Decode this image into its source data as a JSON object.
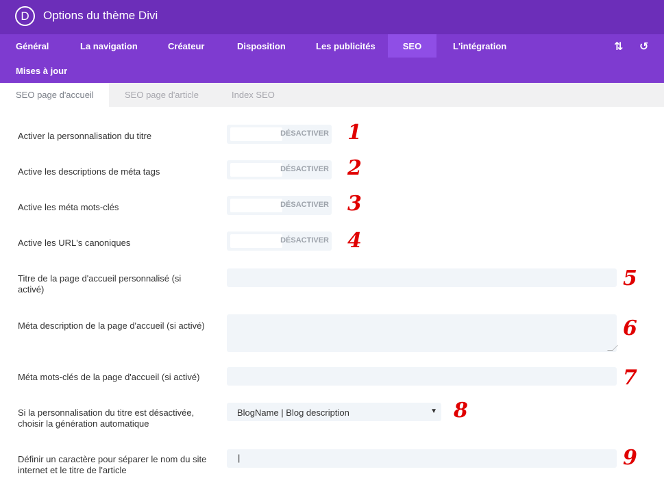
{
  "app": {
    "logo_letter": "D",
    "title": "Options du thème Divi"
  },
  "nav": {
    "tabs": [
      {
        "label": "Général"
      },
      {
        "label": "La navigation"
      },
      {
        "label": "Créateur"
      },
      {
        "label": "Disposition"
      },
      {
        "label": "Les publicités"
      },
      {
        "label": "SEO",
        "active": true
      },
      {
        "label": "L'intégration"
      },
      {
        "label": "Mises à jour"
      }
    ],
    "icons": [
      "sort-arrows-icon",
      "reset-icon"
    ]
  },
  "subtabs": [
    {
      "label": "SEO page d'accueil",
      "active": true
    },
    {
      "label": "SEO page d'article"
    },
    {
      "label": "Index SEO"
    }
  ],
  "options": [
    {
      "label": "Activer la personnalisation du titre",
      "control": "toggle",
      "state": "DÉSACTIVER",
      "marker": "1"
    },
    {
      "label": "Active les descriptions de méta tags",
      "control": "toggle",
      "state": "DÉSACTIVER",
      "marker": "2"
    },
    {
      "label": "Active les méta mots-clés",
      "control": "toggle",
      "state": "DÉSACTIVER",
      "marker": "3"
    },
    {
      "label": "Active les URL's canoniques",
      "control": "toggle",
      "state": "DÉSACTIVER",
      "marker": "4"
    },
    {
      "label": "Titre de la page d'accueil personnalisé (si activé)",
      "control": "text",
      "value": "",
      "marker": "5"
    },
    {
      "label": "Méta description de la page d'accueil (si activé)",
      "control": "textarea",
      "value": "",
      "marker": "6"
    },
    {
      "label": "Méta mots-clés de la page d'accueil (si activé)",
      "control": "text",
      "value": "",
      "marker": "7"
    },
    {
      "label": "Si la personnalisation du titre est désactivée, choisir la génération automatique",
      "control": "select",
      "value": "BlogName | Blog description",
      "marker": "8"
    },
    {
      "label": "Définir un caractère pour séparer le nom du site internet et le titre de l'article",
      "control": "text",
      "value": "|",
      "marker": "9"
    }
  ],
  "colors": {
    "header": "#6c2eb9",
    "nav": "#7e3bd0",
    "active_tab": "#8f4ee6",
    "marker": "#e00000"
  }
}
